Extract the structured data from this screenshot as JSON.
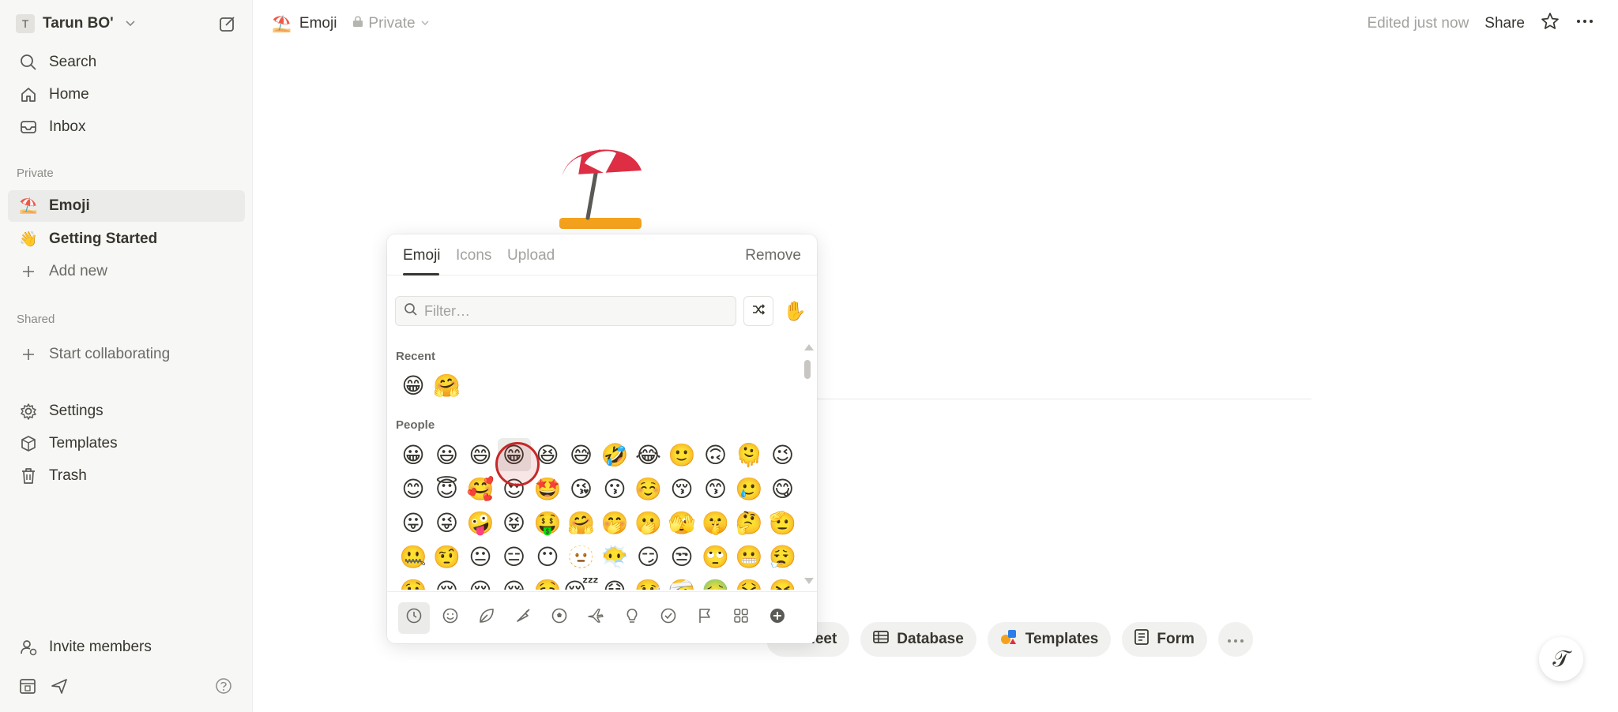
{
  "workspace": {
    "avatar_letter": "T",
    "name": "Tarun BO'"
  },
  "sidebar": {
    "nav": [
      {
        "label": "Search",
        "icon": "search-icon"
      },
      {
        "label": "Home",
        "icon": "home-icon"
      },
      {
        "label": "Inbox",
        "icon": "inbox-icon"
      }
    ],
    "private_label": "Private",
    "private_pages": [
      {
        "label": "Emoji",
        "emoji": "⛱️"
      },
      {
        "label": "Getting Started",
        "emoji": "👋"
      }
    ],
    "add_new": "Add new",
    "shared_label": "Shared",
    "start_collab": "Start collaborating",
    "tools": [
      {
        "label": "Settings",
        "icon": "gear-icon"
      },
      {
        "label": "Templates",
        "icon": "templates-icon"
      },
      {
        "label": "Trash",
        "icon": "trash-icon"
      }
    ],
    "invite": "Invite members"
  },
  "topbar": {
    "page_emoji": "⛱️",
    "page_title": "Emoji",
    "privacy": "Private",
    "edited": "Edited just now",
    "share": "Share"
  },
  "page": {
    "icon": "⛱️"
  },
  "actions": [
    {
      "label": "Meet"
    },
    {
      "label": "Database"
    },
    {
      "label": "Templates"
    },
    {
      "label": "Form"
    }
  ],
  "help_glyph": "𝒯",
  "picker": {
    "tabs": [
      "Emoji",
      "Icons",
      "Upload"
    ],
    "remove": "Remove",
    "filter_placeholder": "Filter…",
    "skin_tone": "✋",
    "recent_label": "Recent",
    "recent": [
      "😁",
      "🤗"
    ],
    "people_label": "People",
    "people": [
      "😀",
      "😃",
      "😄",
      "😁",
      "😆",
      "😅",
      "🤣",
      "😂",
      "🙂",
      "🙃",
      "🫠",
      "😉",
      "😊",
      "😇",
      "🥰",
      "😍",
      "🤩",
      "😘",
      "😗",
      "☺️",
      "😚",
      "😙",
      "🥲",
      "😋",
      "😛",
      "😜",
      "🤪",
      "😝",
      "🤑",
      "🤗",
      "🤭",
      "🫢",
      "🫣",
      "🤫",
      "🤔",
      "🫡",
      "🤐",
      "🤨",
      "😐",
      "😑",
      "😶",
      "🫥",
      "😶‍🌫️",
      "😏",
      "😒",
      "🙄",
      "😬",
      "😮‍💨",
      "🤥",
      "😌",
      "😔",
      "😪",
      "🤤",
      "😴",
      "😷",
      "🤒",
      "🤕",
      "🤢",
      "🤮",
      "🤧"
    ],
    "categories": [
      "recent-icon",
      "smiley-icon",
      "leaf-icon",
      "food-icon",
      "ball-icon",
      "plane-icon",
      "bulb-icon",
      "check-icon",
      "flag-icon",
      "grid-icon",
      "plus-circle-icon"
    ]
  }
}
